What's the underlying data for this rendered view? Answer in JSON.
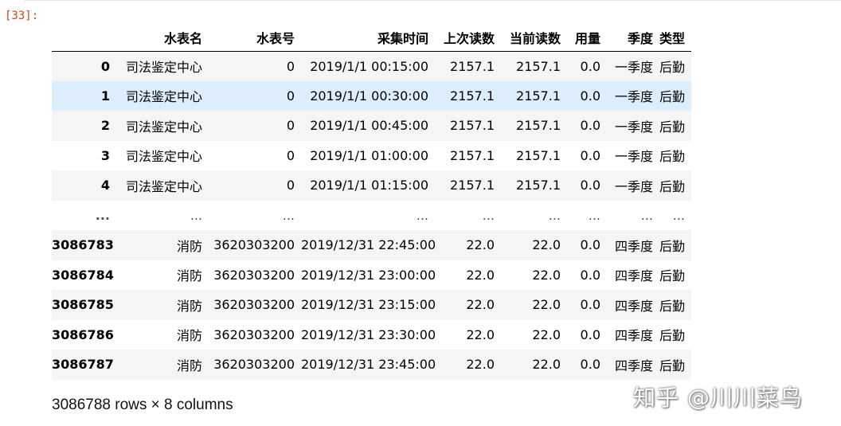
{
  "cell": {
    "prompt": "[33]:"
  },
  "table": {
    "columns": [
      "",
      "水表名",
      "水表号",
      "采集时间",
      "上次读数",
      "当前读数",
      "用量",
      "季度",
      "类型"
    ],
    "rows": [
      {
        "index": "0",
        "name": "司法鉴定中心",
        "meter": "0",
        "time": "2019/1/1 00:15:00",
        "prev": "2157.1",
        "curr": "2157.1",
        "usage": "0.0",
        "quarter": "一季度",
        "type": "后勤"
      },
      {
        "index": "1",
        "name": "司法鉴定中心",
        "meter": "0",
        "time": "2019/1/1 00:30:00",
        "prev": "2157.1",
        "curr": "2157.1",
        "usage": "0.0",
        "quarter": "一季度",
        "type": "后勤"
      },
      {
        "index": "2",
        "name": "司法鉴定中心",
        "meter": "0",
        "time": "2019/1/1 00:45:00",
        "prev": "2157.1",
        "curr": "2157.1",
        "usage": "0.0",
        "quarter": "一季度",
        "type": "后勤"
      },
      {
        "index": "3",
        "name": "司法鉴定中心",
        "meter": "0",
        "time": "2019/1/1 01:00:00",
        "prev": "2157.1",
        "curr": "2157.1",
        "usage": "0.0",
        "quarter": "一季度",
        "type": "后勤"
      },
      {
        "index": "4",
        "name": "司法鉴定中心",
        "meter": "0",
        "time": "2019/1/1 01:15:00",
        "prev": "2157.1",
        "curr": "2157.1",
        "usage": "0.0",
        "quarter": "一季度",
        "type": "后勤"
      },
      {
        "index": "...",
        "name": "...",
        "meter": "...",
        "time": "...",
        "prev": "...",
        "curr": "...",
        "usage": "...",
        "quarter": "...",
        "type": "..."
      },
      {
        "index": "3086783",
        "name": "消防",
        "meter": "3620303200",
        "time": "2019/12/31 22:45:00",
        "prev": "22.0",
        "curr": "22.0",
        "usage": "0.0",
        "quarter": "四季度",
        "type": "后勤"
      },
      {
        "index": "3086784",
        "name": "消防",
        "meter": "3620303200",
        "time": "2019/12/31 23:00:00",
        "prev": "22.0",
        "curr": "22.0",
        "usage": "0.0",
        "quarter": "四季度",
        "type": "后勤"
      },
      {
        "index": "3086785",
        "name": "消防",
        "meter": "3620303200",
        "time": "2019/12/31 23:15:00",
        "prev": "22.0",
        "curr": "22.0",
        "usage": "0.0",
        "quarter": "四季度",
        "type": "后勤"
      },
      {
        "index": "3086786",
        "name": "消防",
        "meter": "3620303200",
        "time": "2019/12/31 23:30:00",
        "prev": "22.0",
        "curr": "22.0",
        "usage": "0.0",
        "quarter": "四季度",
        "type": "后勤"
      },
      {
        "index": "3086787",
        "name": "消防",
        "meter": "3620303200",
        "time": "2019/12/31 23:45:00",
        "prev": "22.0",
        "curr": "22.0",
        "usage": "0.0",
        "quarter": "四季度",
        "type": "后勤"
      }
    ],
    "hovered_row": 1
  },
  "shape_text": "3086788 rows × 8 columns",
  "watermark": "知乎 @川川菜鸟",
  "colors": {
    "prompt": "#d84315",
    "row_stripe": "#f5f5f5",
    "row_hover": "#deedfb"
  }
}
